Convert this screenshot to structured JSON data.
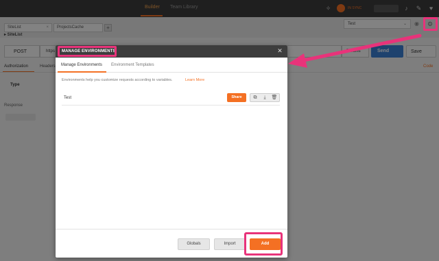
{
  "topbar": {
    "tab_builder": "Builder",
    "tab_team_library": "Team Library",
    "sync_label": "IN SYNC",
    "icons": [
      "satellite-icon",
      "bell-icon",
      "wrench-icon",
      "heart-icon"
    ]
  },
  "background": {
    "tabs": [
      {
        "label": "SiteList"
      },
      {
        "label": "ProjectsCache"
      }
    ],
    "new_tab": "+",
    "breadcrumb": "▸ SiteList",
    "environment_select": "Test",
    "method": "POST",
    "url": "https",
    "params_label": "Params",
    "send_label": "Send",
    "save_label": "Save",
    "request_tabs": [
      "Authorization",
      "Headers"
    ],
    "code_link": "Code",
    "type_label": "Type",
    "response_label": "Response"
  },
  "modal": {
    "title": "MANAGE ENVIRONMENTS",
    "tabs": [
      "Manage Environments",
      "Environment Templates"
    ],
    "description": "Environments help you customize requests according to variables.",
    "learn_more": "Learn More",
    "environments": [
      {
        "name": "Test",
        "share_label": "Share"
      }
    ],
    "footer": {
      "globals_label": "Globals",
      "import_label": "Import",
      "add_label": "Add"
    }
  },
  "colors": {
    "accent": "#f47023",
    "highlight": "#e8337a",
    "send_blue": "#3b7fd4",
    "dark_bar": "#3d3d3d"
  }
}
